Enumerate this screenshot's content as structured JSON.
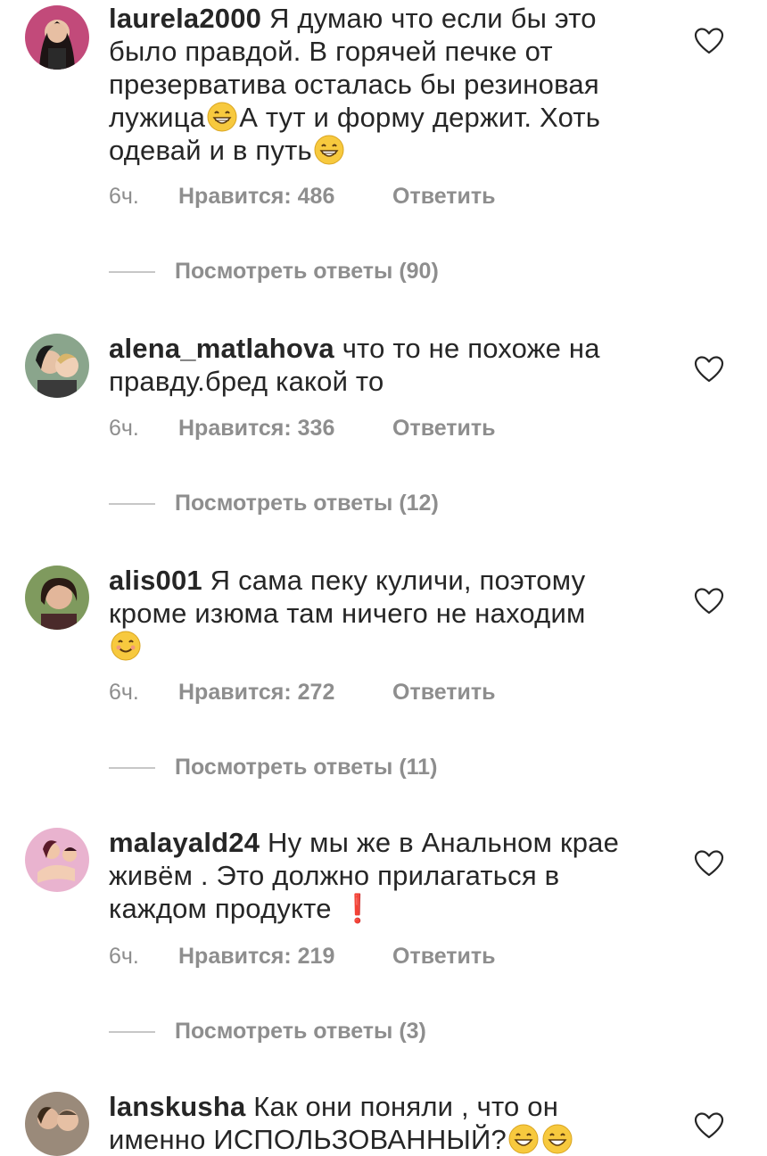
{
  "comments": [
    {
      "username": "laurela2000",
      "text_parts": [
        "Я думаю что если бы это было правдой. В горячей печке от презерватива осталась бы резиновая лужица",
        "А тут и форму держит. Хоть одевай и в путь",
        ""
      ],
      "emoji_icon": "grinning-face-icon",
      "time": "6ч.",
      "likes": "Нравится: 486",
      "reply": "Ответить",
      "view_replies": "Посмотреть ответы (90)"
    },
    {
      "username": "alena_matlahova",
      "text": "что то не похоже на правду.бред какой то",
      "time": "6ч.",
      "likes": "Нравится: 336",
      "reply": "Ответить",
      "view_replies": "Посмотреть ответы (12)"
    },
    {
      "username": "alis001",
      "text": "Я сама пеку куличи, поэтому кроме изюма там ничего не находим",
      "emoji_icon": "smiling-face-icon",
      "time": "6ч.",
      "likes": "Нравится: 272",
      "reply": "Ответить",
      "view_replies": "Посмотреть ответы (11)"
    },
    {
      "username": "malayald24",
      "text": "Ну мы же в Анальном крае живём . Это должно прилагаться в каждом продукте",
      "emoji_icon": "exclamation-mark-icon",
      "emoji_char": "❗",
      "time": "6ч.",
      "likes": "Нравится: 219",
      "reply": "Ответить",
      "view_replies": "Посмотреть ответы (3)"
    },
    {
      "username": "lanskusha",
      "text": "Как они поняли , что он именно ИСПОЛЬЗОВАННЫЙ?",
      "time": "",
      "likes": "",
      "reply": "",
      "view_replies": ""
    }
  ],
  "colors": {
    "text": "#262626",
    "meta": "#8e8e8e",
    "emoji": "#f7c93e",
    "exclamation": "#e0102a"
  },
  "icons": {
    "like": "heart-outline-icon"
  }
}
